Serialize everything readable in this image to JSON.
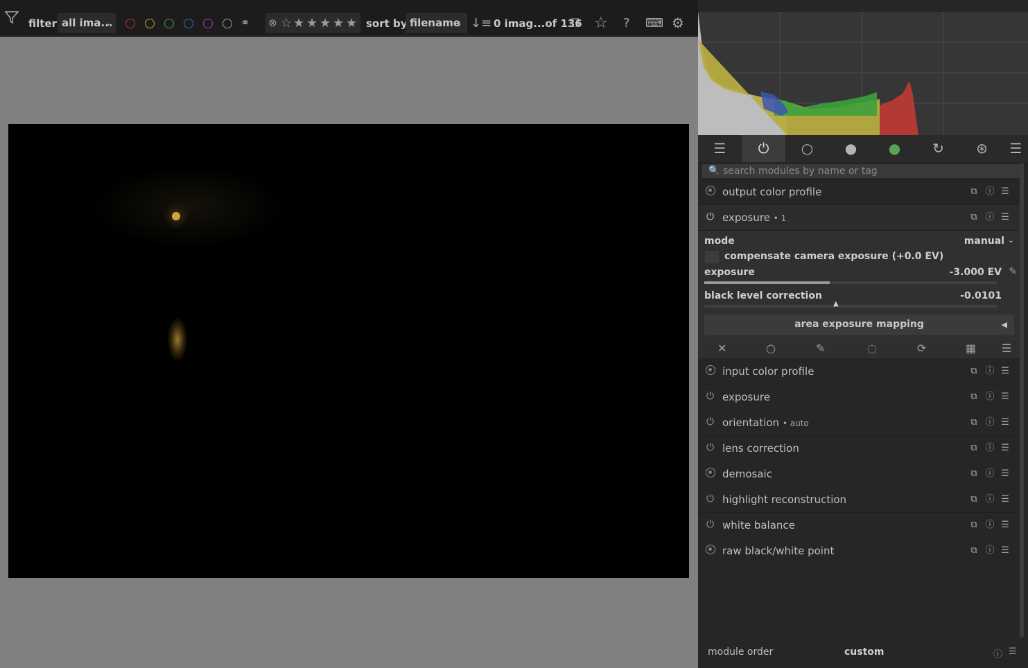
{
  "topbar": {
    "filter_label": "filter",
    "filter_value": "all ima...",
    "color_labels": [
      {
        "name": "red",
        "color": "#c0302c"
      },
      {
        "name": "yellow",
        "color": "#c9a22b"
      },
      {
        "name": "green",
        "color": "#3b9d3b"
      },
      {
        "name": "blue",
        "color": "#3d6ab9"
      },
      {
        "name": "purple",
        "color": "#a33fa8"
      },
      {
        "name": "gray",
        "color": "#9a9a9a"
      }
    ],
    "sort_label": "sort by",
    "sort_value": "filename",
    "count_text": "0 imag...of 136"
  },
  "modules_search": {
    "placeholder": "search modules by name or tag"
  },
  "modules": {
    "output_color_profile": {
      "name": "output color profile"
    },
    "exposure_instance": {
      "name": "exposure",
      "suffix": "• 1"
    },
    "input_color_profile": {
      "name": "input color profile"
    },
    "exposure": {
      "name": "exposure"
    },
    "orientation": {
      "name": "orientation",
      "suffix": "• auto"
    },
    "lens_correction": {
      "name": "lens correction"
    },
    "demosaic": {
      "name": "demosaic"
    },
    "highlight_reconstruction": {
      "name": "highlight reconstruction"
    },
    "white_balance": {
      "name": "white balance"
    },
    "raw_black_white_point": {
      "name": "raw black/white point"
    }
  },
  "exposure_panel": {
    "mode_label": "mode",
    "mode_value": "manual",
    "compensate_label": "compensate camera exposure (+0.0 EV)",
    "exposure_label": "exposure",
    "exposure_value": "-3.000 EV",
    "exposure_fill": 0.43,
    "black_label": "black level correction",
    "black_value": "-0.0101",
    "area_button": "area exposure mapping"
  },
  "footer": {
    "module_order_label": "module order",
    "module_order_value": "custom"
  }
}
